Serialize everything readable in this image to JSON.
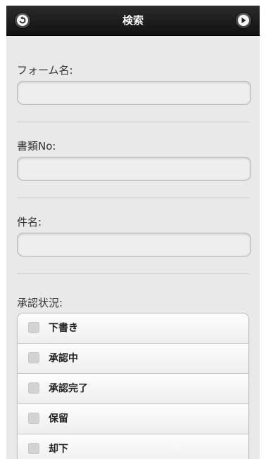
{
  "header": {
    "title": "検索",
    "back_icon": "back-arrow-icon",
    "forward_icon": "play-arrow-icon"
  },
  "form": {
    "form_name_label": "フォーム名:",
    "form_name_value": "",
    "doc_no_label": "書類No:",
    "doc_no_value": "",
    "subject_label": "件名:",
    "subject_value": "",
    "status_label": "承認状況:",
    "status_options": [
      {
        "label": "下書き",
        "checked": false
      },
      {
        "label": "承認中",
        "checked": false
      },
      {
        "label": "承認完了",
        "checked": false
      },
      {
        "label": "保留",
        "checked": false
      },
      {
        "label": "却下",
        "checked": false
      }
    ]
  }
}
